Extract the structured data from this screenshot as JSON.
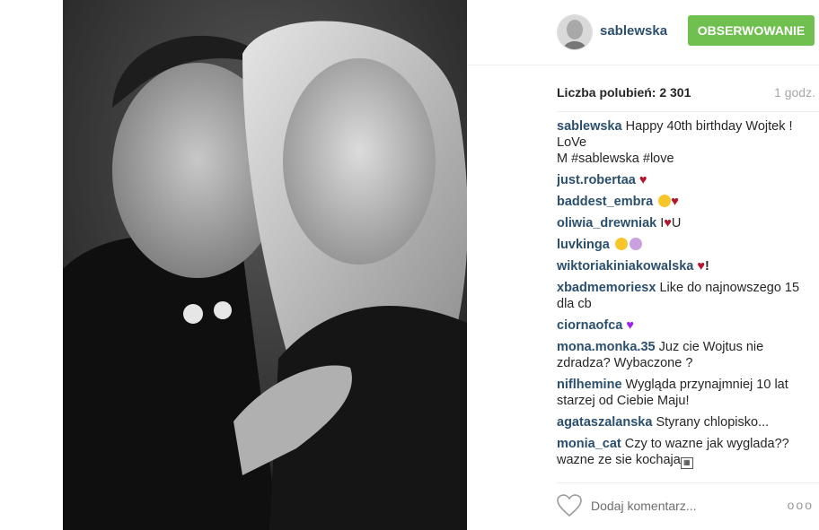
{
  "post": {
    "photo_alt": "",
    "header": {
      "username": "sablewska",
      "follow_label": "OBSERWOWANIE"
    },
    "likes_text": "Liczba polubień: 2 301",
    "time_ago": "1 godz.",
    "caption": {
      "user": "sablewska",
      "text_line1": "Happy 40th birthday Wojtek ! LoVe",
      "text_line2": "M #sablewska #love"
    },
    "comments": [
      {
        "user": "just.robertaa",
        "text": ""
      },
      {
        "user": "baddest_embra",
        "text": ""
      },
      {
        "user": "oliwia_drewniak",
        "text": "I",
        "text_after": "U"
      },
      {
        "user": "luvkinga",
        "text": ""
      },
      {
        "user": "wiktoriakiniakowalska",
        "text": "!"
      },
      {
        "user": "xbadmemoriesx",
        "text": "Like do najnowszego 15 dla cb"
      },
      {
        "user": "ciornaofca",
        "text": ""
      },
      {
        "user": "mona.monka.35",
        "text": "Juz cie Wojtus nie zdradza? Wybaczone ?"
      },
      {
        "user": "niflhemine",
        "text": "Wygląda przynajmniej 10 lat starzej od Ciebie Maju!"
      },
      {
        "user": "agataszalanska",
        "text": "Styrany chlopisko..."
      },
      {
        "user": "monia_cat",
        "text": "Czy to wazne jak wyglada??wazne ze sie kochaja"
      }
    ],
    "add_comment_placeholder": "Dodaj komentarz...",
    "more_label": "ooo"
  },
  "colors": {
    "username": "#2b4f6e",
    "follow_bg": "#70c050",
    "heart": "#b3152d",
    "muted": "#a5a7aa"
  }
}
